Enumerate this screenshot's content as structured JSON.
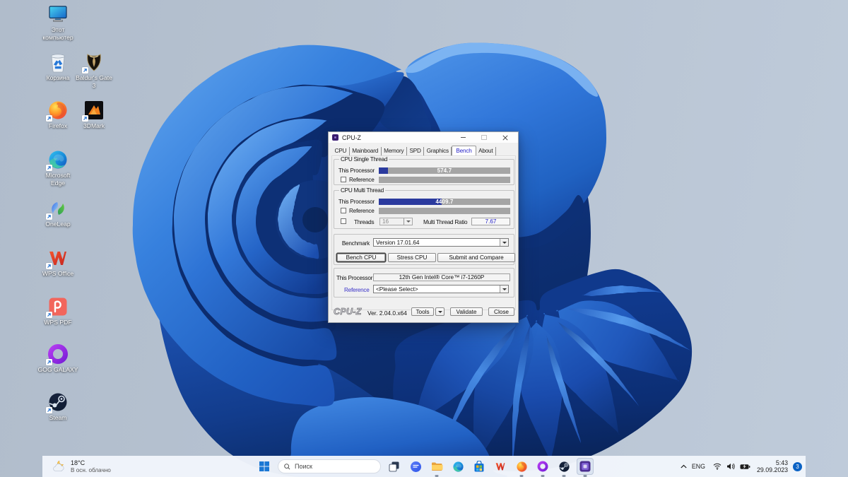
{
  "desktop": {
    "icons": [
      {
        "label": "Этот компьютер"
      },
      {
        "label": "Корзина"
      },
      {
        "label": "Baldur's Gate 3"
      },
      {
        "label": "Firefox"
      },
      {
        "label": "3DMark"
      },
      {
        "label": "Microsoft Edge"
      },
      {
        "label": "OneLeap"
      },
      {
        "label": "WPS Office"
      },
      {
        "label": "WPS PDF"
      },
      {
        "label": "GOG GALAXY"
      },
      {
        "label": "Steam"
      }
    ]
  },
  "window": {
    "title": "CPU-Z",
    "tabs": [
      "CPU",
      "Mainboard",
      "Memory",
      "SPD",
      "Graphics",
      "Bench",
      "About"
    ],
    "selected_tab": "Bench",
    "single_thread": {
      "group": "CPU Single Thread",
      "this_processor_label": "This Processor",
      "value": "574.7",
      "reference_label": "Reference"
    },
    "multi_thread": {
      "group": "CPU Multi Thread",
      "this_processor_label": "This Processor",
      "value": "4409.7",
      "reference_label": "Reference",
      "threads_label": "Threads",
      "threads_value": "16",
      "ratio_label": "Multi Thread Ratio",
      "ratio_value": "7.67"
    },
    "benchmark": {
      "label": "Benchmark",
      "version": "Version 17.01.64",
      "buttons": [
        "Bench CPU",
        "Stress CPU",
        "Submit and Compare"
      ]
    },
    "processor": {
      "label": "This Processor",
      "value": "12th Gen Intel® Core™ i7-1260P",
      "reference_label": "Reference",
      "reference_value": "<Please Select>"
    },
    "footer": {
      "logo": "CPU-Z",
      "version": "Ver. 2.04.0.x64",
      "tools": "Tools",
      "validate": "Validate",
      "close": "Close"
    }
  },
  "taskbar": {
    "weather": {
      "temp": "18°C",
      "condition": "В осн. облачно"
    },
    "search_placeholder": "Поиск",
    "apps": [
      "file-explorer",
      "edge",
      "microsoft-store",
      "wps-office",
      "firefox",
      "gog-galaxy",
      "steam",
      "cpuz"
    ],
    "running_apps": [
      "file-explorer",
      "firefox",
      "gog-galaxy",
      "steam",
      "cpuz"
    ],
    "active_app": "cpuz",
    "tray": {
      "lang": "ENG",
      "time": "5:43",
      "date": "29.09.2023",
      "badge": "3"
    }
  },
  "colors": {
    "wallpaper_background": "#b7c3d2",
    "bloom_blue_mid": "#3177da",
    "bloom_blue_dark": "#0d3076",
    "taskbar_background": "#f1f5fb",
    "window_background": "#f0f0f0",
    "bar_fill_blue": "#2b3a9e",
    "bar_track_gray": "#a5a5a5",
    "bench_tab_text": "#2824c8",
    "reference_link": "#3a32c8",
    "badge_blue": "#0b62c4"
  }
}
